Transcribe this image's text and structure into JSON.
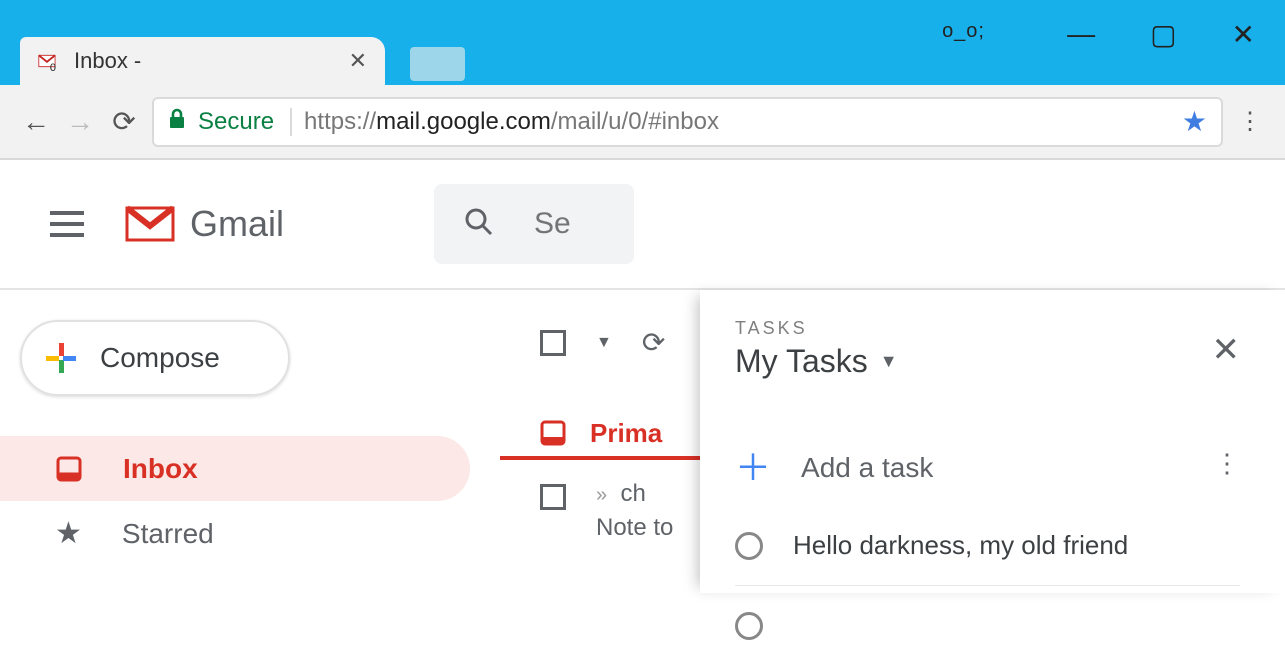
{
  "window": {
    "emoji": "o_o;",
    "tab_title": "Inbox -",
    "tab_badge": "0"
  },
  "browser": {
    "secure_label": "Secure",
    "url_prefix": "https://",
    "url_host": "mail.google.com",
    "url_path": "/mail/u/0/#inbox"
  },
  "gmail": {
    "logo_text": "Gmail",
    "search_placeholder": "Se"
  },
  "compose_label": "Compose",
  "nav": {
    "inbox": "Inbox",
    "starred": "Starred"
  },
  "inbox": {
    "primary_label": "Prima",
    "row_sender": "ch",
    "row_note": "Note to",
    "row_marker": "»"
  },
  "tasks": {
    "subtitle": "TASKS",
    "list_name": "My Tasks",
    "add_label": "Add a task",
    "items": [
      {
        "text": "Hello darkness, my old friend"
      },
      {
        "text": ""
      }
    ]
  }
}
